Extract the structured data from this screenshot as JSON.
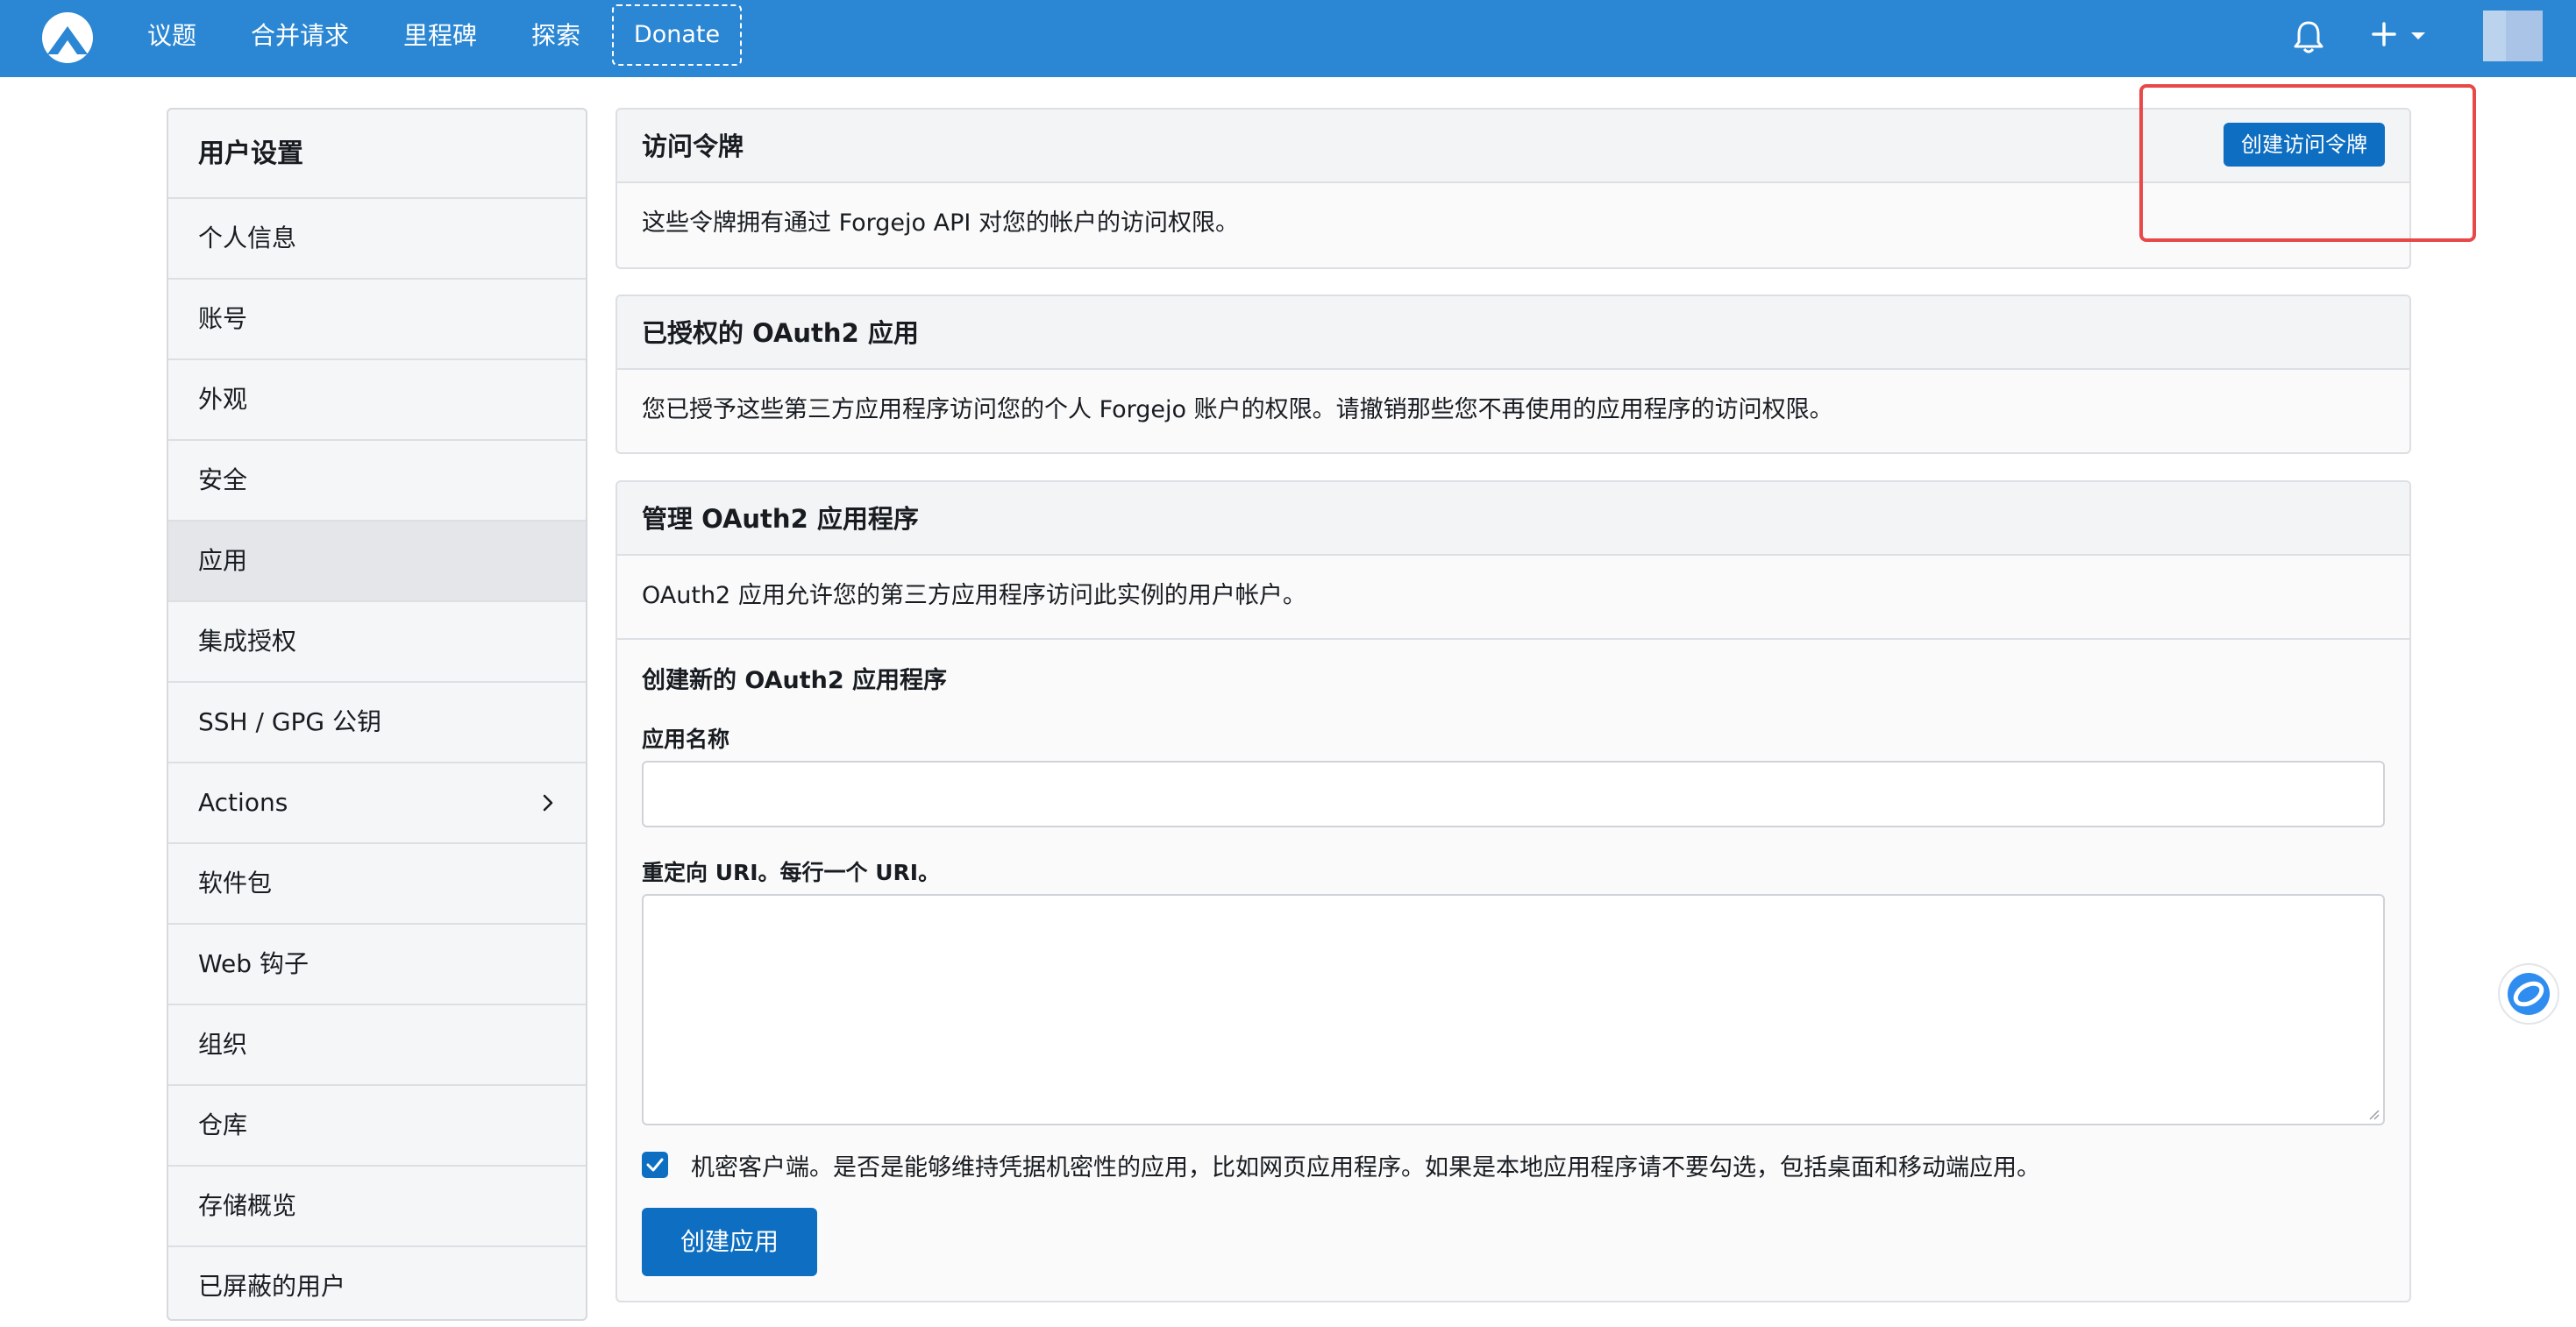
{
  "navbar": {
    "items": [
      "议题",
      "合并请求",
      "里程碑",
      "探索"
    ],
    "donate": "Donate"
  },
  "sidebar": {
    "title": "用户设置",
    "items": [
      {
        "label": "个人信息"
      },
      {
        "label": "账号"
      },
      {
        "label": "外观"
      },
      {
        "label": "安全"
      },
      {
        "label": "应用",
        "active": true
      },
      {
        "label": "集成授权"
      },
      {
        "label": "SSH / GPG 公钥"
      },
      {
        "label": "Actions"
      },
      {
        "label": "软件包"
      },
      {
        "label": "Web 钩子"
      },
      {
        "label": "组织"
      },
      {
        "label": "仓库"
      },
      {
        "label": "存储概览"
      },
      {
        "label": "已屏蔽的用户"
      }
    ]
  },
  "tokens": {
    "title": "访问令牌",
    "button": "创建访问令牌",
    "description": "这些令牌拥有通过 Forgejo API 对您的帐户的访问权限。"
  },
  "authorized": {
    "title": "已授权的 OAuth2 应用",
    "description": "您已授予这些第三方应用程序访问您的个人 Forgejo 账户的权限。请撤销那些您不再使用的应用程序的访问权限。"
  },
  "manage": {
    "title": "管理 OAuth2 应用程序",
    "description": "OAuth2 应用允许您的第三方应用程序访问此实例的用户帐户。",
    "form_title": "创建新的 OAuth2 应用程序",
    "name_label": "应用名称",
    "redirect_label": "重定向 URI。每行一个 URI。",
    "confidential_label": "机密客户端。是否是能够维持凭据机密性的应用，比如网页应用程序。如果是本地应用程序请不要勾选，包括桌面和移动端应用。",
    "confidential_checked": true,
    "submit": "创建应用"
  },
  "colors": {
    "navbar": "#2b87d3",
    "primary": "#0e6fc2",
    "highlight": "#e84848"
  }
}
